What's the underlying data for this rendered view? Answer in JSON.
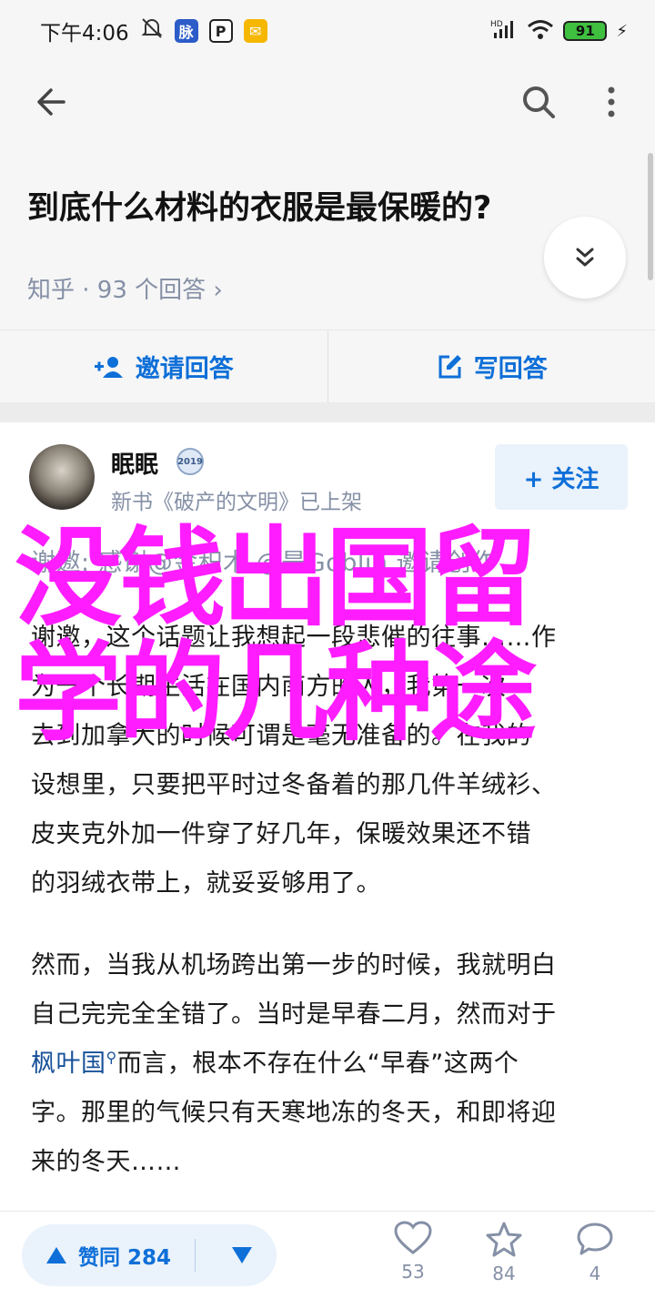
{
  "status_bar": {
    "time": "下午4:06",
    "network": "HD",
    "battery": "91"
  },
  "question": {
    "title": "到底什么材料的衣服是最保暖的?",
    "meta": "知乎 · 93 个回答 ›"
  },
  "actions": {
    "invite_label": "邀请回答",
    "write_label": "写回答"
  },
  "author": {
    "name": "眠眠",
    "badge": "2019",
    "bio": "新书《破产的文明》已上架",
    "follow_label": "+ 关注"
  },
  "answer": {
    "invite_line": "谢邀: 感谢@金积木 @是Goblin 邀请创作",
    "lines": [
      "谢邀，这个话题让我想起一段悲催的往事……作",
      "为一个长期生活在国内南方的人，我第一次",
      "去到加拿大的时候可谓是毫无准备的。在我的",
      "设想里，只要把平时过冬备着的那几件羊绒衫、",
      "皮夹克外加一件穿了好几年，保暖效果还不错",
      "的羽绒衣带上，就妥妥够用了。",
      "然而，当我从机场跨出第一步的时候，我就明白",
      "自己完完全全错了。当时是早春二月，然而对于"
    ],
    "link_text": "枫叶国",
    "line_after_link": "而言，根本不存在什么“早春”这两个",
    "lines_tail": [
      "字。那里的气候只有天寒地冻的冬天，和即将迎",
      "来的冬天……"
    ]
  },
  "watermark": {
    "line1": "没钱出国留",
    "line2": "学的几种途"
  },
  "bottom": {
    "vote_label": "赞同 284",
    "likes": "53",
    "favorites": "84",
    "comments": "4"
  },
  "colors": {
    "accent": "#0e6fd8",
    "meta": "#8590a6",
    "watermark": "#ff1cff"
  }
}
